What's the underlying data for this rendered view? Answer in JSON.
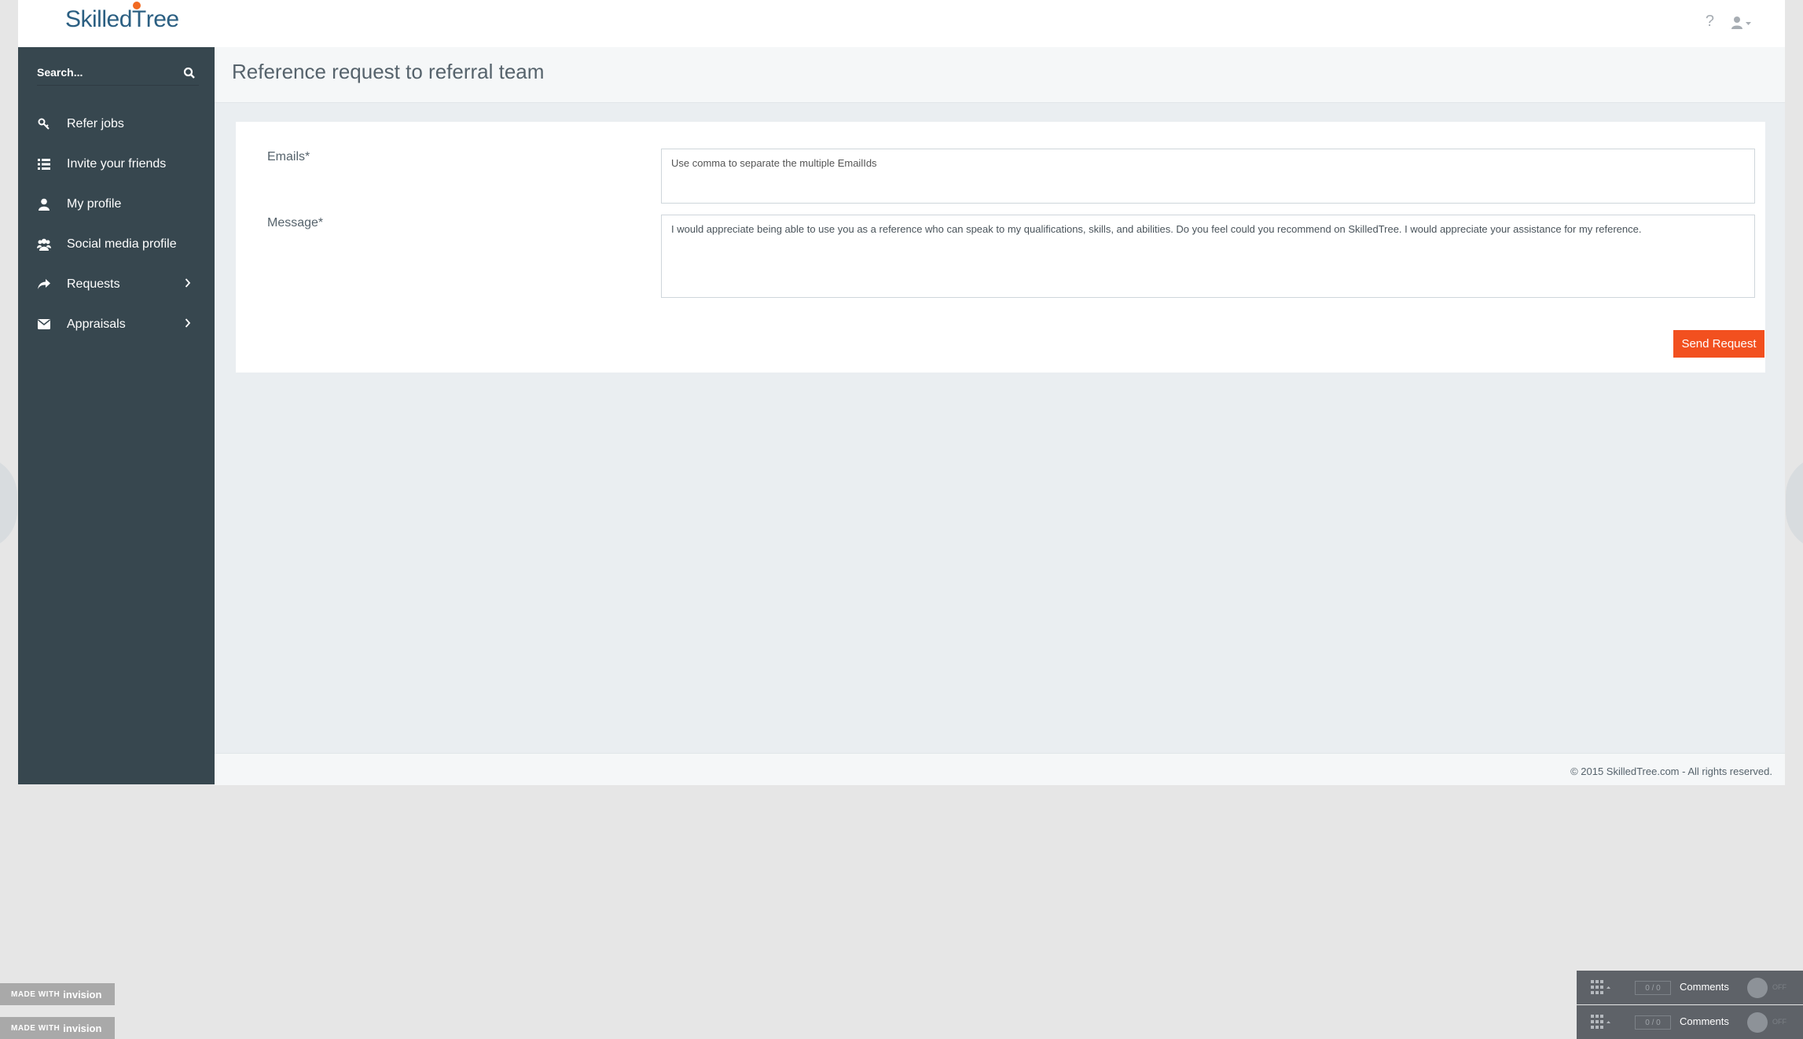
{
  "app": {
    "logo_text_1": "Skilled",
    "logo_text_2": "ree",
    "help": "?"
  },
  "search": {
    "placeholder": "Search..."
  },
  "sidebar": {
    "items": [
      {
        "label": "Refer jobs",
        "icon": "key-icon"
      },
      {
        "label": "Invite your friends",
        "icon": "list-icon"
      },
      {
        "label": "My profile",
        "icon": "user-icon"
      },
      {
        "label": "Social media profile",
        "icon": "users-icon"
      },
      {
        "label": "Requests",
        "icon": "share-icon",
        "has_submenu": true
      },
      {
        "label": "Appraisals",
        "icon": "envelope-icon",
        "has_submenu": true
      }
    ]
  },
  "page": {
    "title": "Reference request to referral team"
  },
  "form": {
    "emails_label": "Emails*",
    "emails_placeholder": "Use comma to separate the multiple EmailIds",
    "message_label": "Message*",
    "message_value": "I would appreciate being able to use you as a reference who can speak to my qualifications, skills, and abilities. Do you feel could you recommend on SkilledTree. I would appreciate your assistance for my reference.",
    "send_label": "Send Request"
  },
  "footer": {
    "copyright": "© 2015 SkilledTree.com - All rights reserved."
  },
  "invision": {
    "badge_text": "MADE WITH",
    "badge_brand": "invision",
    "comments_label": "Comments",
    "counter_a": "0",
    "counter_b": "0",
    "toggle_state": "OFF"
  },
  "colors": {
    "sidebar": "#37474f",
    "accent": "#f2501f",
    "brand": "#2b5f82",
    "logo_person": "#f26a22"
  }
}
